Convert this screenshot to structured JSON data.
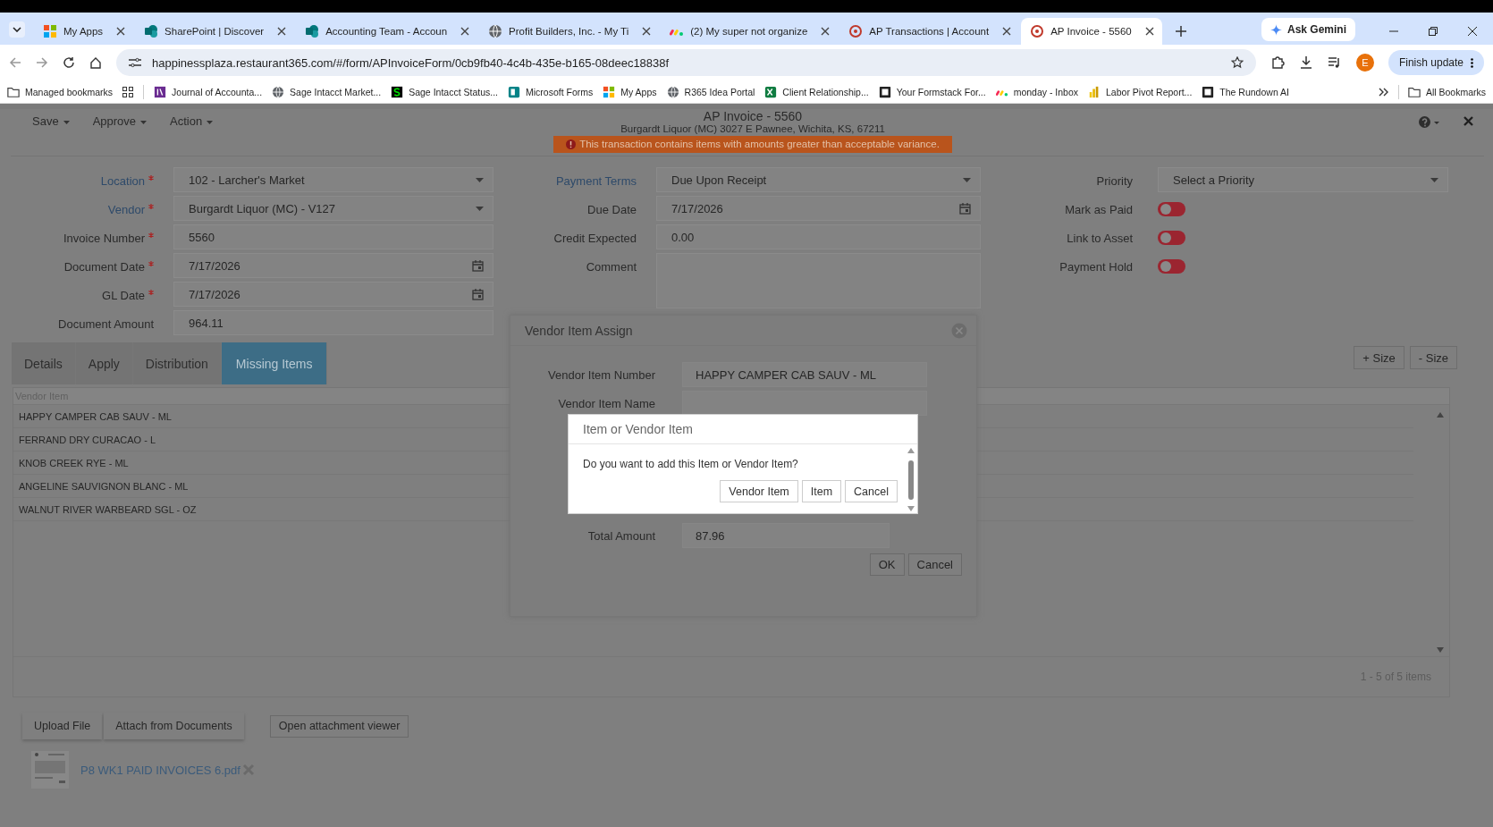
{
  "browser": {
    "tabs": [
      {
        "title": "My Apps",
        "kind": "grid",
        "selected": false
      },
      {
        "title": "SharePoint | Discover",
        "kind": "share",
        "selected": false
      },
      {
        "title": "Accounting Team - Accoun",
        "kind": "share",
        "selected": false
      },
      {
        "title": "Profit Builders, Inc. - My Ti",
        "kind": "globe",
        "selected": false
      },
      {
        "title": "(2) My super not organize",
        "kind": "monday",
        "selected": false
      },
      {
        "title": "AP Transactions | Account",
        "kind": "ring",
        "selected": false
      },
      {
        "title": "AP Invoice - 5560",
        "kind": "ring",
        "selected": true
      }
    ],
    "gemini": "Ask Gemini",
    "url": "happinessplaza.restaurant365.com/#/form/APInvoiceForm/0cb9fb40-4c4b-435e-b165-08deec18838f",
    "profile": "E",
    "update": "Finish update",
    "bookmarks": [
      {
        "title": "Managed bookmarks",
        "kind": "folder"
      },
      {
        "title": "Journal of Accounta...",
        "kind": "journal"
      },
      {
        "title": "Sage Intacct Market...",
        "kind": "globe"
      },
      {
        "title": "Sage Intacct Status...",
        "kind": "sage"
      },
      {
        "title": "Microsoft Forms",
        "kind": "forms"
      },
      {
        "title": "My Apps",
        "kind": "grid"
      },
      {
        "title": "R365 Idea Portal",
        "kind": "globe"
      },
      {
        "title": "Client Relationship...",
        "kind": "excel"
      },
      {
        "title": "Your Formstack For...",
        "kind": "square"
      },
      {
        "title": "monday - Inbox",
        "kind": "monday"
      },
      {
        "title": "Labor Pivot Report...",
        "kind": "chart"
      },
      {
        "title": "The Rundown AI",
        "kind": "square"
      }
    ],
    "all_bookmarks": "All Bookmarks"
  },
  "app": {
    "menus": [
      "Save",
      "Approve",
      "Action"
    ],
    "title": "AP Invoice - 5560",
    "subtitle": "Burgardt Liquor (MC) 3027 E Pawnee, Wichita, KS, 67211",
    "warning": "This transaction contains items with amounts greater than acceptable variance.",
    "form_columns": [
      [
        {
          "label": "Location",
          "required": true,
          "link": true,
          "kind": "select",
          "value": "102 - Larcher's Market"
        },
        {
          "label": "Vendor",
          "required": true,
          "link": true,
          "kind": "select",
          "value": "Burgardt Liquor (MC) - V127"
        },
        {
          "label": "Invoice Number",
          "required": true,
          "link": false,
          "kind": "text",
          "value": "5560"
        },
        {
          "label": "Document Date",
          "required": true,
          "link": false,
          "kind": "date",
          "value": "7/17/2026"
        },
        {
          "label": "GL Date",
          "required": true,
          "link": false,
          "kind": "date",
          "value": "7/17/2026"
        },
        {
          "label": "Document Amount",
          "required": false,
          "link": false,
          "kind": "text",
          "value": "964.11"
        }
      ],
      [
        {
          "label": "Payment Terms",
          "required": false,
          "link": true,
          "kind": "select",
          "value": "Due Upon Receipt"
        },
        {
          "label": "Due Date",
          "required": false,
          "link": false,
          "kind": "date",
          "value": "7/17/2026"
        },
        {
          "label": "Credit Expected",
          "required": false,
          "link": false,
          "kind": "text",
          "value": "0.00"
        },
        {
          "label": "Comment",
          "required": false,
          "link": false,
          "kind": "textarea"
        }
      ],
      [
        {
          "label": "Priority",
          "required": false,
          "link": false,
          "kind": "select",
          "placeholder": "Select a Priority"
        },
        {
          "label": "Mark as Paid",
          "required": false,
          "link": false,
          "kind": "toggle",
          "on": false
        },
        {
          "label": "Link to Asset",
          "required": false,
          "link": false,
          "kind": "toggle",
          "on": false
        },
        {
          "label": "Payment Hold",
          "required": false,
          "link": false,
          "kind": "toggle",
          "on": false
        }
      ]
    ],
    "tabs": [
      {
        "label": "Details",
        "selected": false
      },
      {
        "label": "Apply",
        "selected": false
      },
      {
        "label": "Distribution",
        "selected": false
      },
      {
        "label": "Missing Items",
        "selected": true
      }
    ],
    "size_buttons": [
      "+ Size",
      "- Size"
    ],
    "grid": {
      "columns": [
        "Vendor Item"
      ],
      "rows": [
        "HAPPY CAMPER CAB SAUV - ML",
        "FERRAND DRY CURACAO - L",
        "KNOB CREEK RYE - ML",
        "ANGELINE SAUVIGNON BLANC - ML",
        "WALNUT RIVER WARBEARD SGL - OZ"
      ],
      "pager": "1 - 5 of 5 items"
    },
    "attach_buttons": [
      "Upload File",
      "Attach from Documents"
    ],
    "viewer_button": "Open attachment viewer",
    "attachment": "P8 WK1 PAID INVOICES 6.pdf"
  },
  "modal": {
    "title": "Vendor Item Assign",
    "fields": [
      {
        "label": "Vendor Item Number",
        "value": "HAPPY CAMPER CAB SAUV - ML"
      },
      {
        "label": "Vendor Item Name"
      }
    ],
    "total": {
      "label": "Total Amount",
      "value": "87.96"
    },
    "buttons": [
      "OK",
      "Cancel"
    ]
  },
  "dialog": {
    "title": "Item or Vendor Item",
    "message": "Do you want to add this Item or Vendor Item?",
    "buttons": [
      "Vendor Item",
      "Item",
      "Cancel"
    ]
  }
}
